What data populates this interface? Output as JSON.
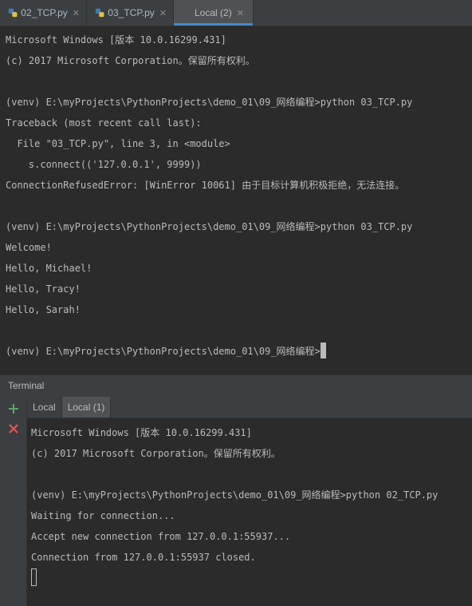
{
  "editor_tabs": [
    {
      "label": "02_TCP.py",
      "active": false
    },
    {
      "label": "03_TCP.py",
      "active": false
    },
    {
      "label": "Local (2)",
      "active": true
    }
  ],
  "top_terminal": {
    "lines": [
      "Microsoft Windows [版本 10.0.16299.431]",
      "(c) 2017 Microsoft Corporation。保留所有权利。",
      "",
      "(venv) E:\\myProjects\\PythonProjects\\demo_01\\09_网络编程>python 03_TCP.py",
      "Traceback (most recent call last):",
      "  File \"03_TCP.py\", line 3, in <module>",
      "    s.connect(('127.0.0.1', 9999))",
      "ConnectionRefusedError: [WinError 10061] 由于目标计算机积极拒绝，无法连接。",
      "",
      "(venv) E:\\myProjects\\PythonProjects\\demo_01\\09_网络编程>python 03_TCP.py",
      "Welcome!",
      "Hello, Michael!",
      "Hello, Tracy!",
      "Hello, Sarah!",
      "",
      "(venv) E:\\myProjects\\PythonProjects\\demo_01\\09_网络编程>"
    ]
  },
  "panel": {
    "title": "Terminal"
  },
  "sub_tabs": [
    {
      "label": "Local",
      "active": false
    },
    {
      "label": "Local (1)",
      "active": true
    }
  ],
  "bottom_terminal": {
    "lines": [
      "Microsoft Windows [版本 10.0.16299.431]",
      "(c) 2017 Microsoft Corporation。保留所有权利。",
      "",
      "(venv) E:\\myProjects\\PythonProjects\\demo_01\\09_网络编程>python 02_TCP.py",
      "Waiting for connection...",
      "Accept new connection from 127.0.0.1:55937...",
      "Connection from 127.0.0.1:55937 closed.",
      ""
    ]
  },
  "icons": {
    "add": "plus-icon",
    "close": "close-icon",
    "python_file": "python-file-icon"
  },
  "colors": {
    "accent": "#4a88c7",
    "add": "#59a869",
    "close": "#e05555"
  }
}
